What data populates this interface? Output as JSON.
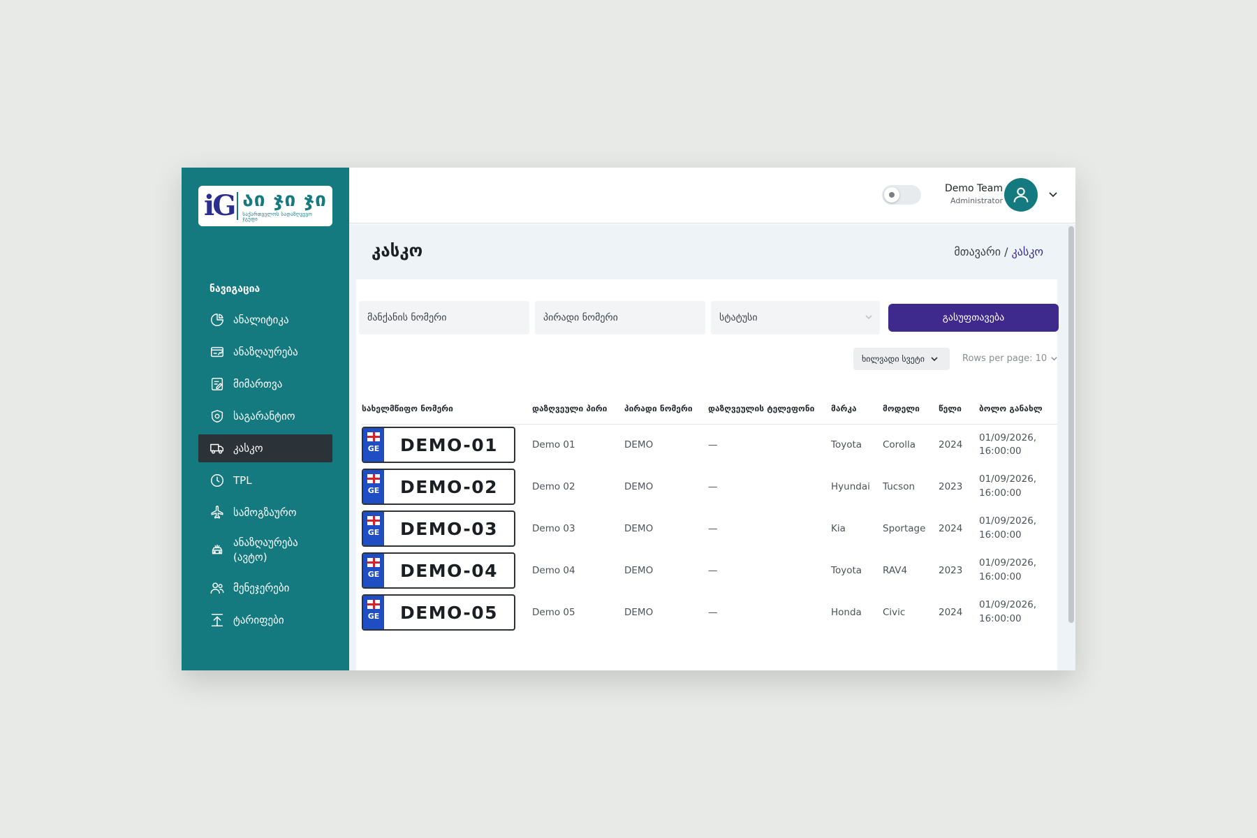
{
  "brand": {
    "logo_mark": "iG",
    "logo_main": "აი ჯი ჯი",
    "logo_sub": "საქართველოს სადაზღვევო ჯგუფი"
  },
  "sidebar": {
    "heading": "ნავიგაცია",
    "items": [
      {
        "label": "ანალიტიკა",
        "icon": "pie-chart-icon"
      },
      {
        "label": "ანაზღაურება",
        "icon": "payment-card-icon"
      },
      {
        "label": "მიმართვა",
        "icon": "edit-document-icon"
      },
      {
        "label": "საგარანტიო",
        "icon": "shield-icon"
      },
      {
        "label": "კასკო",
        "icon": "truck-icon",
        "active": true
      },
      {
        "label": "TPL",
        "icon": "clock-icon"
      },
      {
        "label": "სამოგზაურო",
        "icon": "airplane-icon"
      },
      {
        "label": "ანაზღაურება (ავტო)",
        "icon": "car-damage-icon"
      },
      {
        "label": "მენეჯერები",
        "icon": "users-icon"
      },
      {
        "label": "ტარიფები",
        "icon": "upload-icon"
      }
    ]
  },
  "header": {
    "user_name": "Demo Team",
    "user_role": "Administrator"
  },
  "page": {
    "title": "კასკო",
    "breadcrumb_home": "მთავარი /",
    "breadcrumb_current": "კასკო"
  },
  "filters": {
    "car_number_placeholder": "მანქანის ნომერი",
    "personal_number_placeholder": "პირადი ნომერი",
    "status_placeholder": "სტატუსი",
    "clear_label": "გასუფთავება"
  },
  "tools": {
    "visible_columns_label": "ხილვადი სვეტი",
    "rows_per_page": "Rows per page: 10"
  },
  "table": {
    "headers": [
      "სახელმწიფო ნომერი",
      "დაზღვეული პირი",
      "პირადი ნომერი",
      "დაზღვეულის ტელეფონი",
      "მარკა",
      "მოდელი",
      "წელი",
      "ბოლო განახლ"
    ],
    "plate_country": "GE",
    "rows": [
      {
        "plate": "DEMO-01",
        "insured": "Demo 01",
        "personal": "DEMO",
        "phone": "—",
        "make": "Toyota",
        "model": "Corolla",
        "year": "2024",
        "date": "01/09/2026,",
        "time": "16:00:00"
      },
      {
        "plate": "DEMO-02",
        "insured": "Demo 02",
        "personal": "DEMO",
        "phone": "—",
        "make": "Hyundai",
        "model": "Tucson",
        "year": "2023",
        "date": "01/09/2026,",
        "time": "16:00:00"
      },
      {
        "plate": "DEMO-03",
        "insured": "Demo 03",
        "personal": "DEMO",
        "phone": "—",
        "make": "Kia",
        "model": "Sportage",
        "year": "2024",
        "date": "01/09/2026,",
        "time": "16:00:00"
      },
      {
        "plate": "DEMO-04",
        "insured": "Demo 04",
        "personal": "DEMO",
        "phone": "—",
        "make": "Toyota",
        "model": "RAV4",
        "year": "2023",
        "date": "01/09/2026,",
        "time": "16:00:00"
      },
      {
        "plate": "DEMO-05",
        "insured": "Demo 05",
        "personal": "DEMO",
        "phone": "—",
        "make": "Honda",
        "model": "Civic",
        "year": "2024",
        "date": "01/09/2026,",
        "time": "16:00:00"
      }
    ]
  },
  "colors": {
    "sidebar": "#147a80",
    "active_nav": "#2c3338",
    "primary_button": "#3d2a8c",
    "plate_band": "#1f4ec4"
  }
}
